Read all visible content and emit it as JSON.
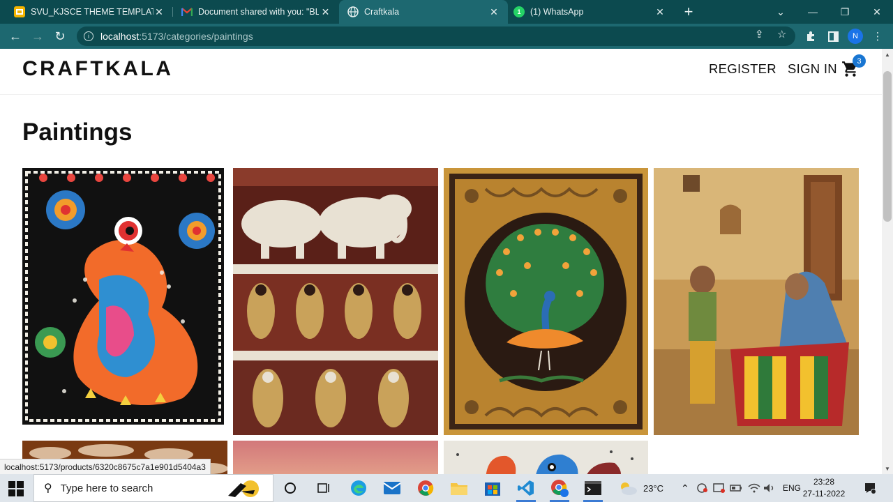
{
  "browser": {
    "tabs": [
      {
        "title": "SVU_KJSCE THEME TEMPLATE FOR",
        "icon": "slides-icon",
        "active": false
      },
      {
        "title": "Document shared with you: \"BLA",
        "icon": "gmail-icon",
        "active": false
      },
      {
        "title": "Craftkala",
        "icon": "globe-icon",
        "active": true
      },
      {
        "title": "(1) WhatsApp",
        "icon": "whatsapp-icon",
        "active": false
      }
    ],
    "url_host": "localhost",
    "url_path": ":5173/categories/paintings",
    "profile_initial": "N",
    "status_url": "localhost:5173/products/6320c8675c7a1e901d5404a3"
  },
  "site": {
    "logo": "CRAFTKALA",
    "nav": {
      "register": "REGISTER",
      "sign_in": "SIGN IN"
    },
    "cart_count": "3",
    "page_title": "Paintings"
  },
  "products": [
    {
      "name": "madhubani-peacock-painting"
    },
    {
      "name": "kalamkari-elephants-painting"
    },
    {
      "name": "peacock-medallion-painting"
    },
    {
      "name": "two-women-embroidery-painting"
    },
    {
      "name": "clouds-painting"
    },
    {
      "name": "pink-sunset-painting"
    },
    {
      "name": "folk-animals-painting"
    }
  ],
  "taskbar": {
    "search_placeholder": "Type here to search",
    "temperature": "23°C",
    "language": "ENG",
    "time": "23:28",
    "date": "27-11-2022"
  },
  "colors": {
    "tab_strip": "#0c4a4f",
    "toolbar": "#1d6870",
    "cart_badge": "#1976d2"
  }
}
